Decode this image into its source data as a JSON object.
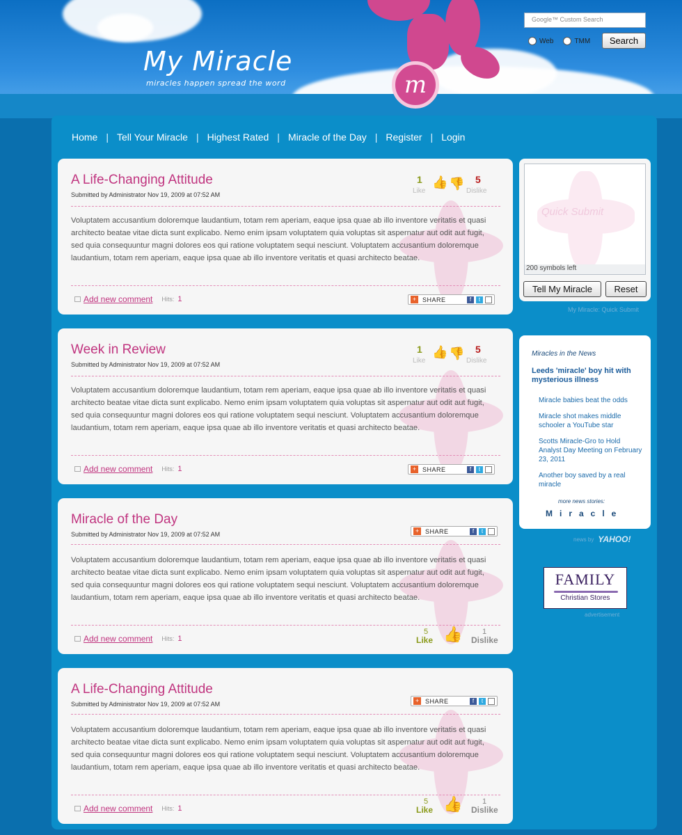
{
  "site": {
    "title": "My Miracle",
    "tagline": "miracles happen     spread the word",
    "logo_letter": "m"
  },
  "search": {
    "placeholder": "Google™ Custom Search",
    "radio_web": "Web",
    "radio_tmm": "TMM",
    "button": "Search"
  },
  "nav": {
    "items": [
      "Home",
      "Tell Your Miracle",
      "Highest Rated",
      "Miracle of the Day",
      "Register",
      "Login"
    ],
    "separator": "|"
  },
  "articles": [
    {
      "title": "A Life-Changing Attitude",
      "meta": "Submitted by Administrator Nov 19, 2009 at 07:52 AM",
      "body": "Voluptatem accusantium doloremque laudantium, totam rem aperiam, eaque ipsa quae ab illo inventore veritatis et quasi architecto beatae vitae dicta sunt explicabo. Nemo enim ipsam voluptatem quia voluptas sit aspernatur aut odit aut fugit, sed quia consequuntur magni dolores eos qui ratione voluptatem sequi nesciunt. Voluptatem accusantium doloremque laudantium, totam rem aperiam, eaque ipsa quae ab illo inventore veritatis et quasi architecto beatae.",
      "comment_link": "Add new comment",
      "hits_label": "Hits:",
      "hits": "1",
      "likes": "1",
      "like_label": "Like",
      "dislikes": "5",
      "dislike_label": "Dislike",
      "share_label": "SHARE"
    },
    {
      "title": "Week in Review",
      "meta": "Submitted by Administrator Nov 19, 2009 at 07:52 AM",
      "body": "Voluptatem accusantium doloremque laudantium, totam rem aperiam, eaque ipsa quae ab illo inventore veritatis et quasi architecto beatae vitae dicta sunt explicabo. Nemo enim ipsam voluptatem quia voluptas sit aspernatur aut odit aut fugit, sed quia consequuntur magni dolores eos qui ratione voluptatem sequi nesciunt. Voluptatem accusantium doloremque laudantium, totam rem aperiam, eaque ipsa quae ab illo inventore veritatis et quasi architecto beatae.",
      "comment_link": "Add new comment",
      "hits_label": "Hits:",
      "hits": "1",
      "likes": "1",
      "like_label": "Like",
      "dislikes": "5",
      "dislike_label": "Dislike",
      "share_label": "SHARE"
    },
    {
      "title": "Miracle of the Day",
      "meta": "Submitted by Administrator Nov 19, 2009 at 07:52 AM",
      "body": "Voluptatem accusantium doloremque laudantium, totam rem aperiam, eaque ipsa quae ab illo inventore veritatis et quasi architecto beatae vitae dicta sunt explicabo. Nemo enim ipsam voluptatem quia voluptas sit aspernatur aut odit aut fugit, sed quia consequuntur magni dolores eos qui ratione voluptatem sequi nesciunt. Voluptatem accusantium doloremque laudantium, totam rem aperiam, eaque ipsa quae ab illo inventore veritatis et quasi architecto beatae.",
      "comment_link": "Add new comment",
      "hits_label": "Hits:",
      "hits": "1",
      "likes": "5",
      "like_label": "Like",
      "dislikes": "1",
      "dislike_label": "Dislike",
      "share_label": "SHARE"
    },
    {
      "title": "A Life-Changing Attitude",
      "meta": "Submitted by Administrator Nov 19, 2009 at 07:52 AM",
      "body": "Voluptatem accusantium doloremque laudantium, totam rem aperiam, eaque ipsa quae ab illo inventore veritatis et quasi architecto beatae vitae dicta sunt explicabo. Nemo enim ipsam voluptatem quia voluptas sit aspernatur aut odit aut fugit, sed quia consequuntur magni dolores eos qui ratione voluptatem sequi nesciunt. Voluptatem accusantium doloremque laudantium, totam rem aperiam, eaque ipsa quae ab illo inventore veritatis et quasi architecto beatae.",
      "comment_link": "Add new comment",
      "hits_label": "Hits:",
      "hits": "1",
      "likes": "5",
      "like_label": "Like",
      "dislikes": "1",
      "dislike_label": "Dislike",
      "share_label": "SHARE"
    }
  ],
  "quick_submit": {
    "placeholder": "Quick Submit",
    "counter": "200 symbols left",
    "submit_button": "Tell My Miracle",
    "reset_button": "Reset",
    "caption": "My Miracle: Quick Submit"
  },
  "news": {
    "heading": "Miracles in the News",
    "lead": "Leeds 'miracle' boy hit with mysterious illness",
    "items": [
      "Miracle babies beat the odds",
      "Miracle shot makes middle schooler a YouTube star",
      "Scotts Miracle-Gro to Hold Analyst Day Meeting on February 23, 2011",
      "Another boy saved by a real miracle"
    ],
    "more_label": "more news stories:",
    "more_link": "Miracle",
    "news_by": "news by",
    "provider": "YAHOO!"
  },
  "ad": {
    "line1": "FAMILY",
    "line2": "Christian Stores",
    "caption": "advertisement"
  },
  "colors": {
    "accent": "#c0347f",
    "background": "#0b8ec9",
    "like": "#8a9a1a",
    "dislike": "#b81c1c"
  }
}
